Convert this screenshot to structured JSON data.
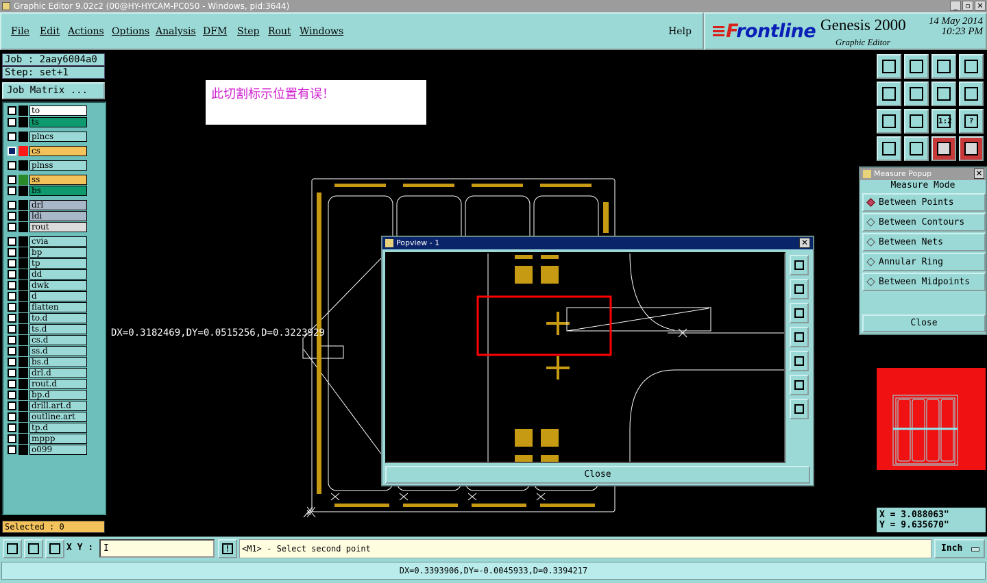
{
  "window": {
    "title": "Graphic Editor 9.02c2 (00@HY-HYCAM-PC050 - Windows, pid:3644)",
    "buttons": [
      "_",
      "▫",
      "✕"
    ]
  },
  "menu": {
    "items": [
      "File",
      "Edit",
      "Actions",
      "Options",
      "Analysis",
      "DFM",
      "Step",
      "Rout",
      "Windows"
    ],
    "help": "Help"
  },
  "brand": {
    "logo_f": "≡F",
    "logo_rest": "rontline",
    "product": "Genesis 2000",
    "subtitle": "Graphic Editor",
    "date": "14 May 2014",
    "time": "10:23 PM"
  },
  "job": {
    "job_line": "Job : 2aay6004a0",
    "step_line": "Step: set+1",
    "matrix_button": "Job Matrix ..."
  },
  "layers": [
    {
      "name": "to",
      "color": "#000000",
      "bg": "#ffffff"
    },
    {
      "name": "ts",
      "color": "#000000",
      "bg": "#0e9a6e"
    },
    {
      "name": "plncs",
      "color": "#000000",
      "bg": "#9bd9d6"
    },
    {
      "name": "cs",
      "color": "#ff1a1a",
      "bg": "#f4c25a",
      "active": true
    },
    {
      "name": "plnss",
      "color": "#000000",
      "bg": "#9bd9d6"
    },
    {
      "name": "ss",
      "color": "#2a8a2a",
      "bg": "#f4c25a"
    },
    {
      "name": "bs",
      "color": "#000000",
      "bg": "#0e9a6e"
    },
    {
      "name": "drl",
      "color": "#000000",
      "bg": "#a9b8c8"
    },
    {
      "name": "ldi",
      "color": "#000000",
      "bg": "#a9b8c8"
    },
    {
      "name": "rout",
      "color": "#000000",
      "bg": "#dcdcdc"
    },
    {
      "name": "cvia",
      "color": "#000000",
      "bg": "#9bd9d6"
    },
    {
      "name": "bp",
      "color": "#000000",
      "bg": "#9bd9d6"
    },
    {
      "name": "tp",
      "color": "#000000",
      "bg": "#9bd9d6"
    },
    {
      "name": "dd",
      "color": "#000000",
      "bg": "#9bd9d6"
    },
    {
      "name": "dwk",
      "color": "#000000",
      "bg": "#9bd9d6"
    },
    {
      "name": "d",
      "color": "#000000",
      "bg": "#9bd9d6"
    },
    {
      "name": "flatten",
      "color": "#000000",
      "bg": "#9bd9d6"
    },
    {
      "name": "to.d",
      "color": "#000000",
      "bg": "#9bd9d6"
    },
    {
      "name": "ts.d",
      "color": "#000000",
      "bg": "#9bd9d6"
    },
    {
      "name": "cs.d",
      "color": "#000000",
      "bg": "#9bd9d6"
    },
    {
      "name": "ss.d",
      "color": "#000000",
      "bg": "#9bd9d6"
    },
    {
      "name": "bs.d",
      "color": "#000000",
      "bg": "#9bd9d6"
    },
    {
      "name": "drl.d",
      "color": "#000000",
      "bg": "#9bd9d6"
    },
    {
      "name": "rout.d",
      "color": "#000000",
      "bg": "#9bd9d6"
    },
    {
      "name": "bp.d",
      "color": "#000000",
      "bg": "#9bd9d6"
    },
    {
      "name": "drill.art.d",
      "color": "#000000",
      "bg": "#9bd9d6"
    },
    {
      "name": "outline.art",
      "color": "#000000",
      "bg": "#9bd9d6"
    },
    {
      "name": "tp.d",
      "color": "#000000",
      "bg": "#9bd9d6"
    },
    {
      "name": "mppp",
      "color": "#000000",
      "bg": "#9bd9d6"
    },
    {
      "name": "o099",
      "color": "#000000",
      "bg": "#9bd9d6"
    }
  ],
  "selected": "Selected : 0",
  "canvas": {
    "note": "此切割标示位置有误！",
    "measure_readout": "DX=0.3182469,DY=0.0515256,D=0.3223929"
  },
  "popview": {
    "title": "Popview - 1",
    "close": "Close",
    "tool_icons": [
      "zoom-fit-icon",
      "zoom-in-icon",
      "zoom-out-icon",
      "pan-left-icon",
      "pan-right-icon",
      "zoom-home-icon",
      "pan-icon"
    ]
  },
  "measure_popup": {
    "title": "Measure Popup",
    "heading": "Measure Mode",
    "options": [
      "Between Points",
      "Between Contours",
      "Between Nets",
      "Annular Ring",
      "Between Midpoints"
    ],
    "selected_index": 0,
    "close": "Close"
  },
  "toolbar_right": {
    "icons": [
      "load-icon",
      "save-icon",
      "home-icon",
      "snap-icon",
      "pan-left-icon",
      "pan-right-icon",
      "mirror-icon",
      "rotate-icon",
      "zoom-fit-icon",
      "center-icon",
      "ratio-icon",
      "help-icon",
      "tools-icon",
      "grid-icon",
      "net-icon",
      "net-alt-icon"
    ],
    "ratio_label": "1:2",
    "help_label": "?"
  },
  "coords": {
    "x": "X = 3.088063\"",
    "y": "Y = 9.635670\""
  },
  "bottom": {
    "xy_label": "X Y :",
    "xy_value": "I",
    "alert": "!",
    "prompt": "<M1> - Select second point",
    "unit": "Inch"
  },
  "status": "DX=0.3393906,DY=-0.0045933,D=0.3394217",
  "colors": {
    "panel": "#9bd9d6",
    "highlight": "#ff0000",
    "pad": "#c79a14"
  }
}
